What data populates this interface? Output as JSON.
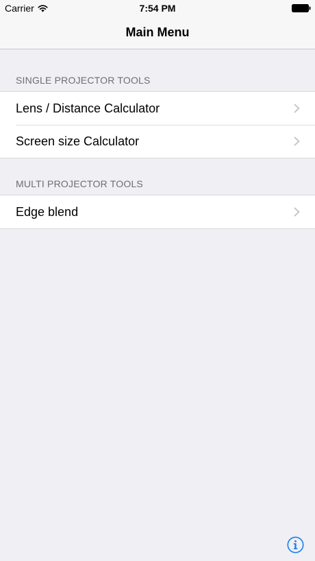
{
  "status_bar": {
    "carrier": "Carrier",
    "time": "7:54 PM"
  },
  "nav": {
    "title": "Main Menu"
  },
  "sections": [
    {
      "header": "SINGLE PROJECTOR TOOLS",
      "items": [
        {
          "label": "Lens / Distance Calculator"
        },
        {
          "label": "Screen size Calculator"
        }
      ]
    },
    {
      "header": "MULTI PROJECTOR TOOLS",
      "items": [
        {
          "label": "Edge blend"
        }
      ]
    }
  ],
  "icons": {
    "wifi": "wifi-icon",
    "battery": "battery-icon",
    "chevron": "chevron-right-icon",
    "info": "info-icon"
  },
  "colors": {
    "background": "#efeff4",
    "nav_background": "#f7f7f7",
    "section_header": "#6d6d72",
    "chevron": "#c7c7cc",
    "accent": "#1a7ee6"
  }
}
